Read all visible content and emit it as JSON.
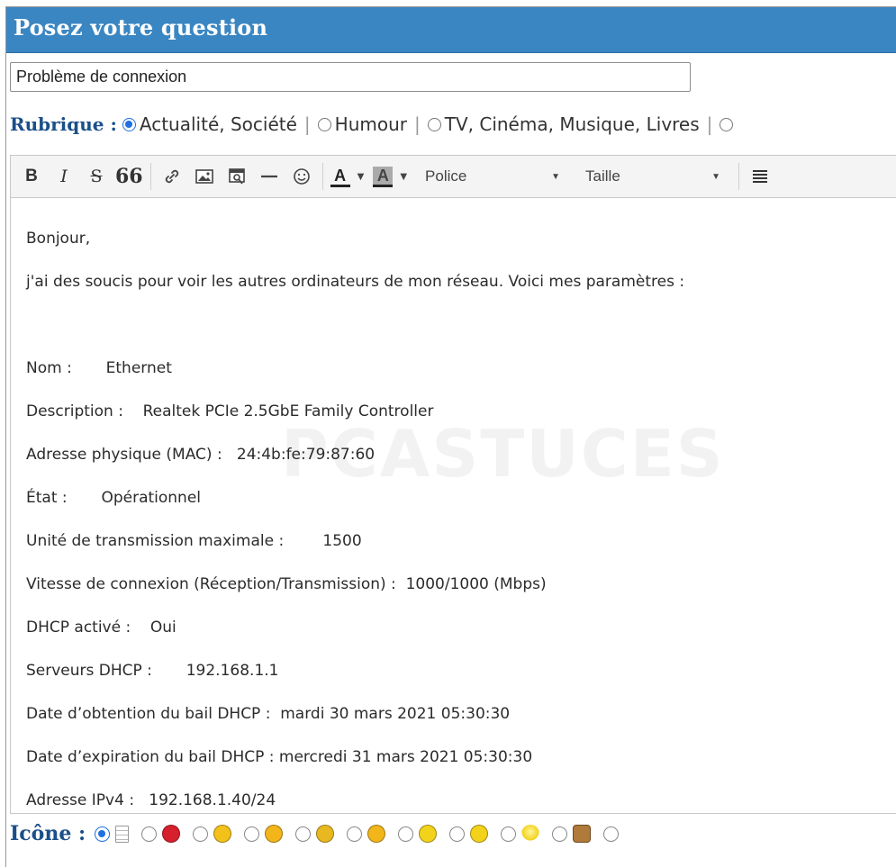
{
  "header": {
    "title": "Posez votre question"
  },
  "subject": {
    "value": "Problème de connexion"
  },
  "rubrique": {
    "label": "Rubrique :",
    "options": [
      "Actualité, Société",
      "Humour",
      "TV, Cinéma, Musique, Livres"
    ],
    "selected": "Actualité, Société",
    "separator": "|"
  },
  "toolbar": {
    "bold": "B",
    "italic": "I",
    "strike": "S",
    "quote": "66",
    "text_color": "A",
    "bg_color": "A",
    "font_combo": "Police",
    "size_combo": "Taille"
  },
  "editor": {
    "watermark": "PCASTUCES",
    "lines": [
      "Bonjour,",
      "j'ai des soucis pour voir les autres ordinateurs de mon réseau. Voici mes paramètres :",
      "",
      "Nom :       Ethernet",
      "Description :    Realtek PCIe 2.5GbE Family Controller",
      "Adresse physique (MAC) :   24:4b:fe:79:87:60",
      "État :       Opérationnel",
      "Unité de transmission maximale :        1500",
      "Vitesse de connexion (Réception/Transmission) :  1000/1000 (Mbps)",
      "DHCP activé :    Oui",
      "Serveurs DHCP :       192.168.1.1",
      "Date d’obtention du bail DHCP :  mardi 30 mars 2021 05:30:30",
      "Date d’expiration du bail DHCP : mercredi 31 mars 2021 05:30:30",
      "Adresse IPv4 :   192.168.1.40/24"
    ]
  },
  "icons": {
    "label": "Icône :",
    "items": [
      {
        "name": "document",
        "color": "#ffffff"
      },
      {
        "name": "angry",
        "color": "#d6202c"
      },
      {
        "name": "cool",
        "color": "#f2c21a"
      },
      {
        "name": "sunglasses",
        "color": "#f2b51a"
      },
      {
        "name": "surprised",
        "color": "#e8b820"
      },
      {
        "name": "tongue",
        "color": "#f2b51a"
      },
      {
        "name": "confused",
        "color": "#f2d21a"
      },
      {
        "name": "neutral",
        "color": "#f2d21a"
      },
      {
        "name": "idea",
        "color": "#f2d21a"
      },
      {
        "name": "thumbs-up",
        "color": "#b07a3a"
      }
    ]
  },
  "colors": {
    "title_bg": "#3a86c2",
    "label_blue": "#1a4f8a",
    "radio_blue": "#1f6fe0"
  }
}
